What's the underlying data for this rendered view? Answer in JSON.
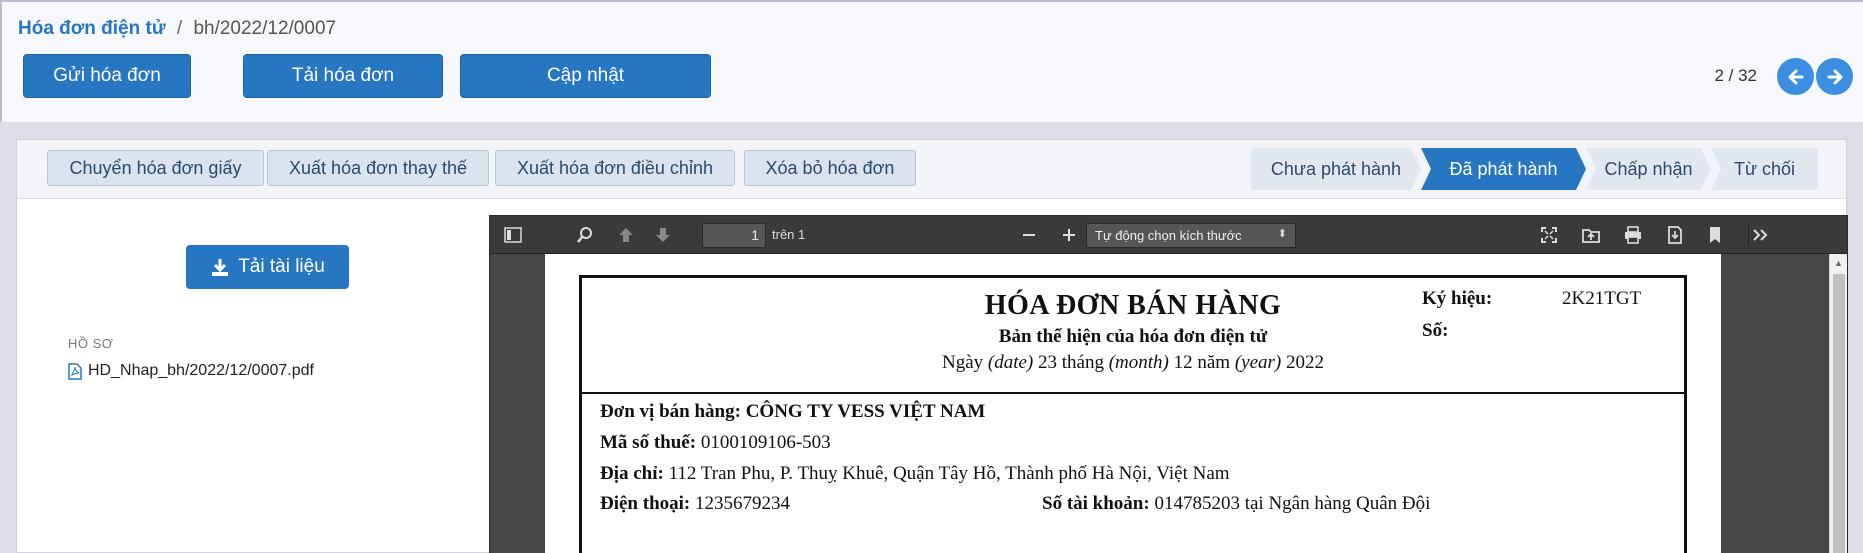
{
  "breadcrumb": {
    "parent": "Hóa đơn điện tử",
    "separator": "/",
    "current": "bh/2022/12/0007"
  },
  "actions": {
    "send": "Gửi hóa đơn",
    "download": "Tải hóa đơn",
    "update": "Cập nhật"
  },
  "pager": {
    "text": "2 / 32"
  },
  "toolbar_chips": {
    "convert": "Chuyển hóa đơn giấy",
    "replace": "Xuất hóa đơn thay thế",
    "adjust": "Xuất hóa đơn điều chỉnh",
    "cancel": "Xóa bỏ hóa đơn"
  },
  "status_steps": [
    {
      "label": "Chưa phát hành",
      "active": false
    },
    {
      "label": "Đã phát hành",
      "active": true
    },
    {
      "label": "Chấp nhận",
      "active": false
    },
    {
      "label": "Từ chối",
      "active": false
    }
  ],
  "sidebar": {
    "download_label": "Tải tài liệu",
    "section_label": "HỒ SƠ",
    "file_name": "HD_Nhap_bh/2022/12/0007.pdf"
  },
  "viewer": {
    "page_value": "1",
    "page_of": "trên 1",
    "zoom_option": "Tự động chọn kích thước"
  },
  "invoice": {
    "title": "HÓA ĐƠN BÁN HÀNG",
    "subtitle": "Bản thể hiện của hóa đơn điện tử",
    "date_prefix": "Ngày",
    "date_en": "(date)",
    "day": "23",
    "month_word": "tháng",
    "month_en": "(month)",
    "month": "12",
    "year_word": "năm",
    "year_en": "(year)",
    "year": "2022",
    "symbol_label": "Ký hiệu:",
    "symbol_value": "2K21TGT",
    "number_label": "Số:",
    "seller_label": "Đơn vị bán hàng:",
    "seller_value": "CÔNG TY VESS VIỆT NAM",
    "tax_label": "Mã số thuế:",
    "tax_value": "0100109106-503",
    "address_label": "Địa chỉ:",
    "address_value": "112 Tran Phu, P. Thuỵ Khuê, Quận Tây Hồ, Thành phố Hà Nội, Việt Nam",
    "phone_label": "Điện thoại:",
    "phone_value": "1235679234",
    "account_label": "Số tài khoản:",
    "account_value": "014785203 tại Ngân hàng Quân Đội"
  },
  "colors": {
    "primary": "#2776c2",
    "accent": "#3b8fe0",
    "chip_bg": "#dbe3ee",
    "viewer_bg": "#474747"
  }
}
